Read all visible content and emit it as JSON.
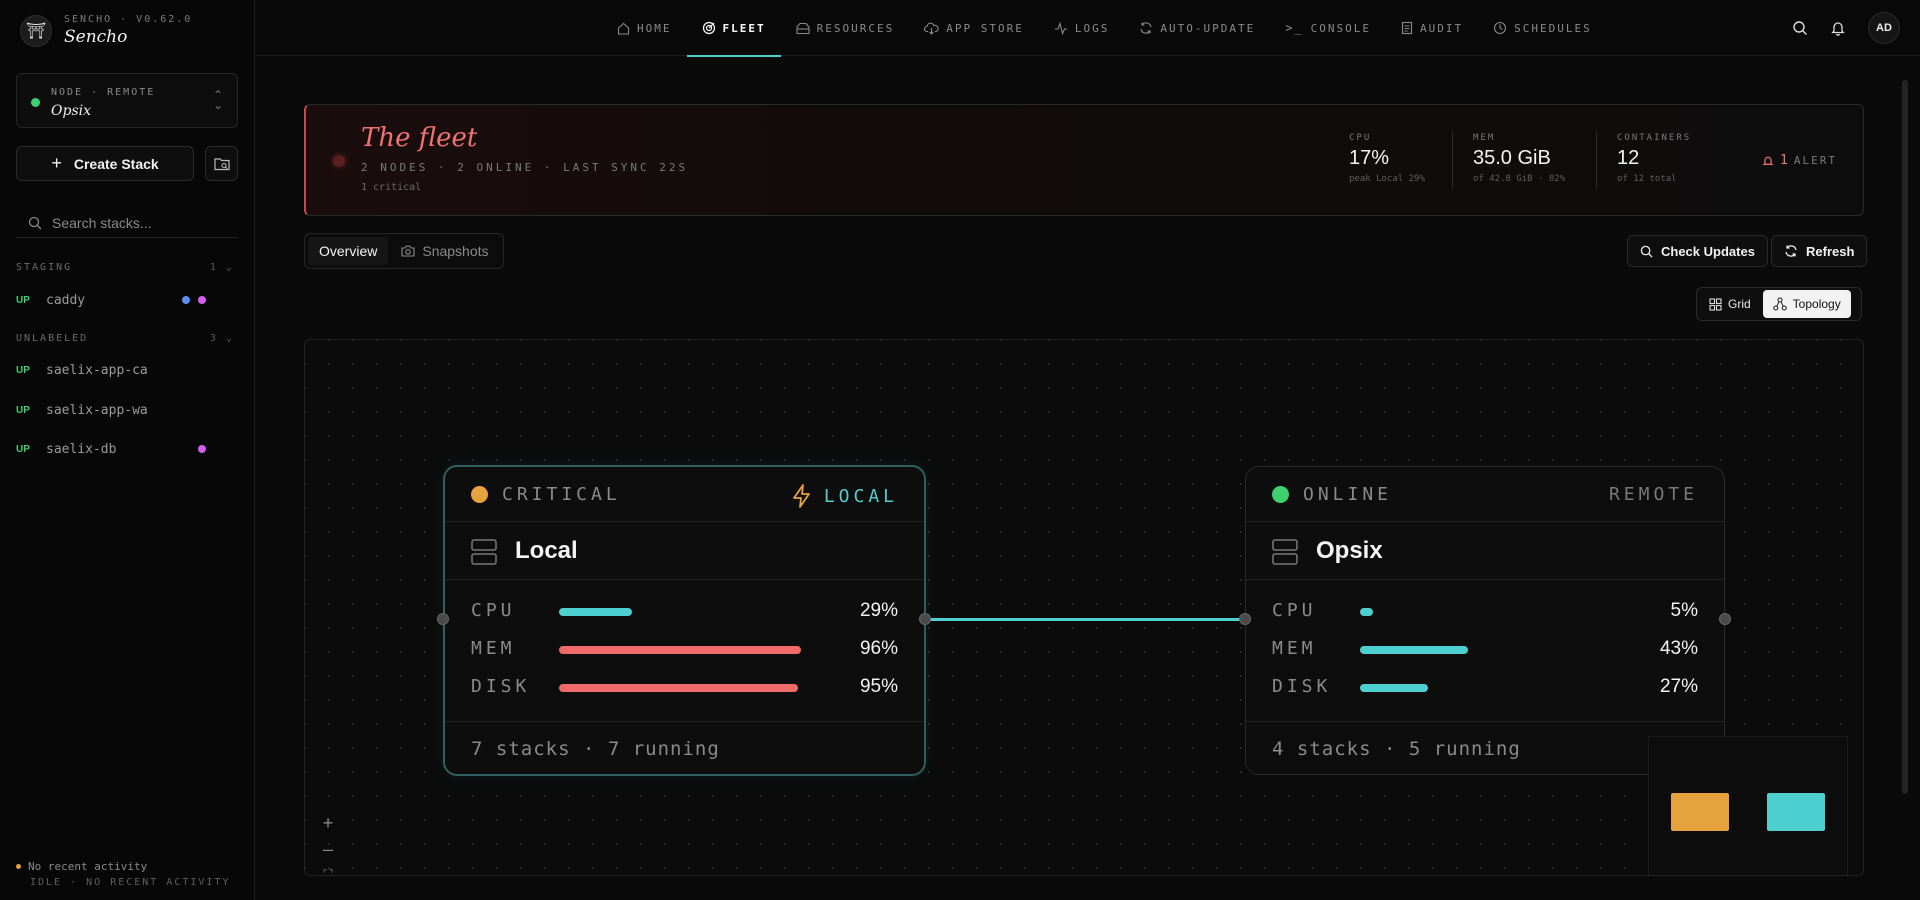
{
  "brand": {
    "version": "SENCHO · V0.62.0",
    "name": "Sencho"
  },
  "node_selector": {
    "kind": "NODE · REMOTE",
    "name": "Opsix",
    "status_color": "#3ecf6e"
  },
  "sidebar": {
    "create_label": "Create Stack",
    "search_placeholder": "Search stacks...",
    "groups": [
      {
        "label": "STAGING",
        "count": "1",
        "stacks": [
          {
            "status": "UP",
            "name": "caddy",
            "dots": [
              "#5b8def",
              "#d55ef0"
            ]
          }
        ]
      },
      {
        "label": "UNLABELED",
        "count": "3",
        "stacks": [
          {
            "status": "UP",
            "name": "saelix-app-ca",
            "dots": []
          },
          {
            "status": "UP",
            "name": "saelix-app-wa",
            "dots": []
          },
          {
            "status": "UP",
            "name": "saelix-db",
            "dots": [
              "#d55ef0"
            ]
          }
        ]
      }
    ],
    "activity": {
      "line1": "No recent activity",
      "line2": "IDLE · NO RECENT ACTIVITY"
    }
  },
  "nav": {
    "items": [
      {
        "label": "HOME",
        "icon": "home-icon"
      },
      {
        "label": "FLEET",
        "icon": "fleet-icon",
        "active": true
      },
      {
        "label": "RESOURCES",
        "icon": "resources-icon"
      },
      {
        "label": "APP STORE",
        "icon": "app-store-icon"
      },
      {
        "label": "LOGS",
        "icon": "logs-icon"
      },
      {
        "label": "AUTO-UPDATE",
        "icon": "auto-update-icon"
      },
      {
        "label": "CONSOLE",
        "icon": "console-icon"
      },
      {
        "label": "AUDIT",
        "icon": "audit-icon"
      },
      {
        "label": "SCHEDULES",
        "icon": "schedules-icon"
      }
    ],
    "avatar": "AD"
  },
  "fleet": {
    "title": "The fleet",
    "subtitle": "2 NODES · 2 ONLINE · LAST SYNC 22S",
    "critical": "1 critical",
    "cpu": {
      "label": "CPU",
      "value": "17%",
      "sub": "peak Local 29%"
    },
    "mem": {
      "label": "MEM",
      "value": "35.0 GiB",
      "sub": "of 42.8 GiB · 82%"
    },
    "containers": {
      "label": "CONTAINERS",
      "value": "12",
      "sub": "of 12 total"
    },
    "alert": {
      "count": "1",
      "label": "ALERT"
    }
  },
  "tabs": {
    "overview": "Overview",
    "snapshots": "Snapshots"
  },
  "actions": {
    "check_updates": "Check Updates",
    "refresh": "Refresh"
  },
  "view_toggle": {
    "grid": "Grid",
    "topology": "Topology",
    "selected": "Topology"
  },
  "colors": {
    "accent": "#4ecfcf",
    "critical": "#e6a23c",
    "online": "#3ecf6e",
    "danger": "#f06a6a"
  },
  "topology": {
    "nodes": [
      {
        "status": "CRITICAL",
        "tag": "LOCAL",
        "name": "Local",
        "metrics": [
          {
            "label": "CPU",
            "pct": "29%",
            "value": 0.29
          },
          {
            "label": "MEM",
            "pct": "96%",
            "value": 0.96
          },
          {
            "label": "DISK",
            "pct": "95%",
            "value": 0.95
          }
        ],
        "footer": "7 stacks · 7 running"
      },
      {
        "status": "ONLINE",
        "tag": "REMOTE",
        "name": "Opsix",
        "metrics": [
          {
            "label": "CPU",
            "pct": "5%",
            "value": 0.05
          },
          {
            "label": "MEM",
            "pct": "43%",
            "value": 0.43
          },
          {
            "label": "DISK",
            "pct": "27%",
            "value": 0.27
          }
        ],
        "footer": "4 stacks · 5 running"
      }
    ]
  }
}
